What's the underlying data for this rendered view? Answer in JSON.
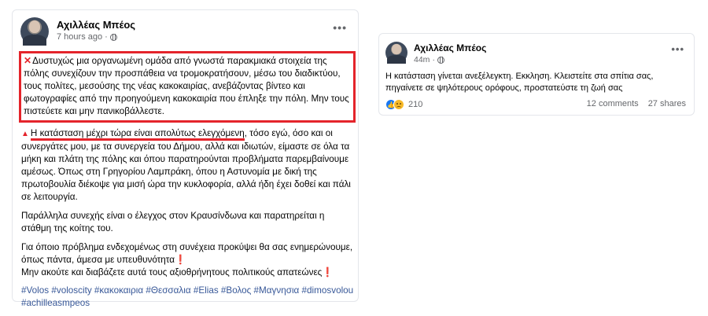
{
  "left_post": {
    "author": "Αχιλλέας Μπέος",
    "time": "7 hours ago",
    "separator": "·",
    "more": "•••",
    "boxed_text": "Δυστυχώς μια οργανωμένη ομάδα από γνωστά παρακμιακά στοιχεία της πόλης συνεχίζουν την προσπάθεια να τρομοκρατήσουν, μέσω του διαδικτύου, τους πολίτες, μεσούσης της νέας κακοκαιρίας, ανεβάζοντας βίντεο και φωτογραφίες από την προηγούμενη κακοκαιρία που έπληξε την πόλη. Μην τους πιστεύετε και μην πανικοβάλλεστε.",
    "underlined_text": "Η κατάσταση μέχρι τώρα είναι απολύτως ελεγχόμενη",
    "para2_rest": ", τόσο εγώ, όσο και οι συνεργάτες μου, με τα συνεργεία του Δήμου, αλλά και ιδιωτών, είμαστε σε όλα τα μήκη και πλάτη της πόλης και όπου παρατηρούνται προβλήματα παρεμβαίνουμε αμέσως. Όπως στη Γρηγορίου Λαμπράκη, όπου η Αστυνομία με δική της πρωτοβουλία διέκοψε για μισή ώρα την κυκλοφορία, αλλά ήδη έχει δοθεί και πάλι σε λειτουργία.",
    "para3": "Παράλληλα συνεχής είναι ο έλεγχος στον  Κραυσίνδωνα και παρατηρείται η στάθμη της κοίτης του.",
    "para4_line1": "Για όποιο πρόβλημα ενδεχομένως στη συνέχεια προκύψει θα σας ενημερώνουμε, όπως πάντα, άμεσα με υπευθυνότητα",
    "para4_line2": "Μην ακούτε και διαβάζετε αυτά τους αξιοθρήνητους πολιτικούς απατεώνες",
    "hashtags": [
      "#Volos",
      "#voloscity",
      "#κακοκαιρια",
      "#Θεσσαλια",
      "#Elias",
      "#Βολος",
      "#Μαγνησια",
      "#dimosvolou",
      "#achilleasmpeos"
    ]
  },
  "right_post": {
    "author": "Αχιλλέας Μπέος",
    "time": "44m",
    "separator": "·",
    "more": "•••",
    "text": "Η κατάσταση γίνεται ανεξέλεγκτη. Εκκληση. Κλειστείτε στα σπίτια σας, πηγαίνετε σε ψηλότερους ορόφους, προστατεύστε τη ζωή σας",
    "reaction_count": "210",
    "comments": "12 comments",
    "shares": "27 shares"
  },
  "colors": {
    "highlight_red": "#e4242b",
    "link_blue": "#385898",
    "meta_gray": "#65676b"
  }
}
